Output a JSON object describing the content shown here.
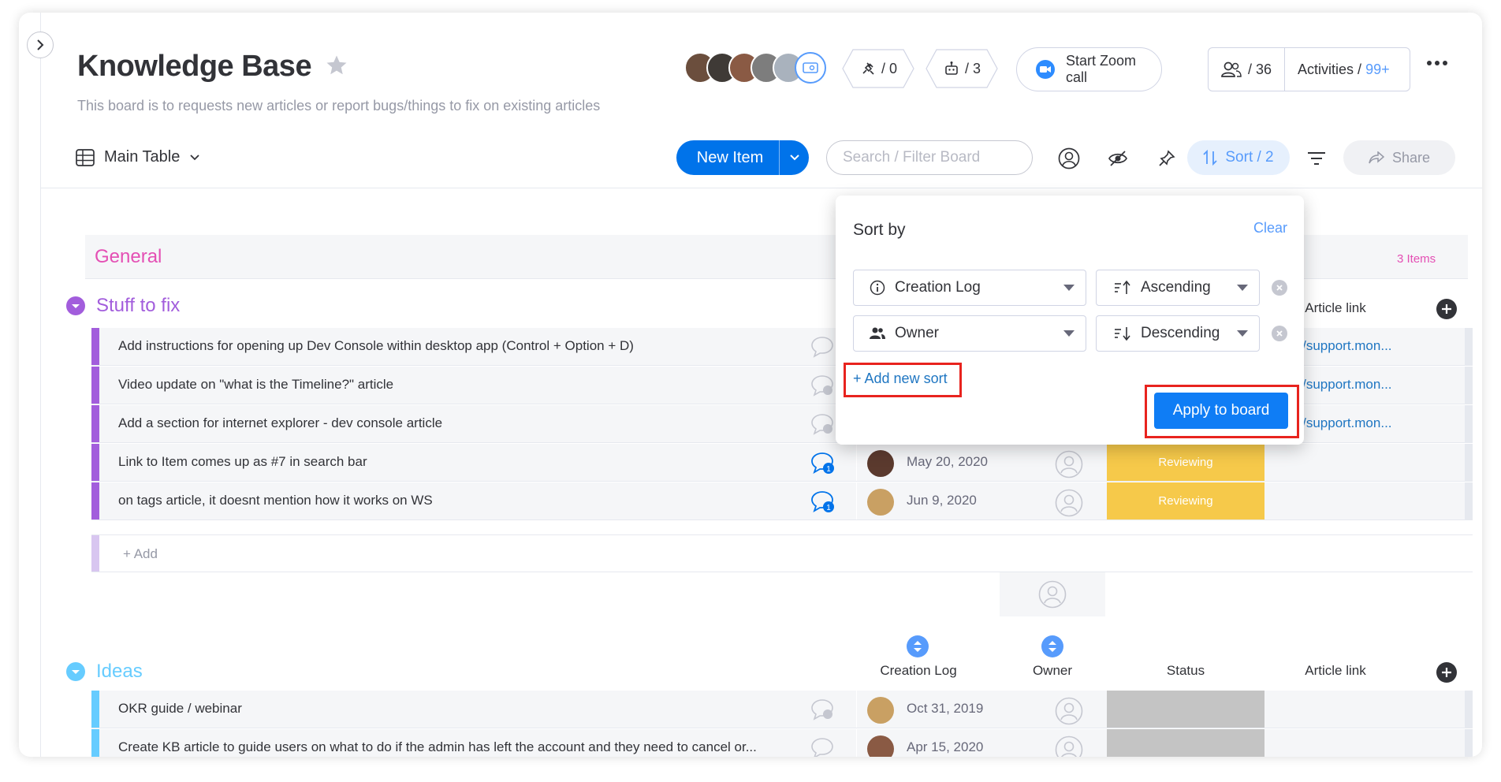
{
  "header": {
    "title": "Knowledge Base",
    "description": "This board is to requests new articles or report bugs/things to fix on existing articles",
    "integrations": "/ 0",
    "automations": "/ 3",
    "zoom_label": "Start Zoom call",
    "members_count": "/ 36",
    "activities_label": "Activities /",
    "activities_count": "99+"
  },
  "toolbar": {
    "view_label": "Main Table",
    "new_item_label": "New Item",
    "search_placeholder": "Search / Filter Board",
    "sort_label": "Sort / 2",
    "share_label": "Share"
  },
  "groups": {
    "general": {
      "title": "General",
      "count": "3 Items"
    },
    "stuff": {
      "title": "Stuff to fix",
      "color": "#a25ddc",
      "columns": {
        "article_link": "Article link"
      },
      "rows": [
        {
          "name": "Add instructions for opening up Dev Console within desktop app (Control + Option + D)",
          "link": "tps://support.mon..."
        },
        {
          "name": "Video update on \"what is the Timeline?\" article",
          "link": "tps://support.mon..."
        },
        {
          "name": "Add a section for internet explorer - dev console article",
          "link": "tps://support.mon..."
        },
        {
          "name": "Link to Item comes up as #7 in search bar",
          "date": "May 20, 2020",
          "status": "Reviewing",
          "chat_count": "1"
        },
        {
          "name": "on tags article, it doesnt mention how it works on WS",
          "date": "Jun 9, 2020",
          "status": "Reviewing",
          "chat_count": "1"
        }
      ],
      "add_label": "+ Add"
    },
    "ideas": {
      "title": "Ideas",
      "color": "#66ccff",
      "columns": {
        "creation_log": "Creation Log",
        "owner": "Owner",
        "status": "Status",
        "article_link": "Article link"
      },
      "rows": [
        {
          "name": "OKR guide / webinar",
          "date": "Oct 31, 2019"
        },
        {
          "name": "Create KB article to guide users on what to do if the admin has left the account and they need to cancel or...",
          "date": "Apr 15, 2020"
        }
      ]
    }
  },
  "sort_popover": {
    "title": "Sort by",
    "clear_label": "Clear",
    "rules": [
      {
        "column": "Creation Log",
        "direction": "Ascending"
      },
      {
        "column": "Owner",
        "direction": "Descending"
      }
    ],
    "add_sort_label": "+ Add new sort",
    "apply_label": "Apply to board"
  },
  "colors": {
    "primary": "#0073ea",
    "reviewing": "#f6c94a",
    "empty_status": "#c4c4c4",
    "general_pink": "#e44fb4",
    "highlight_red": "#e8231e"
  }
}
